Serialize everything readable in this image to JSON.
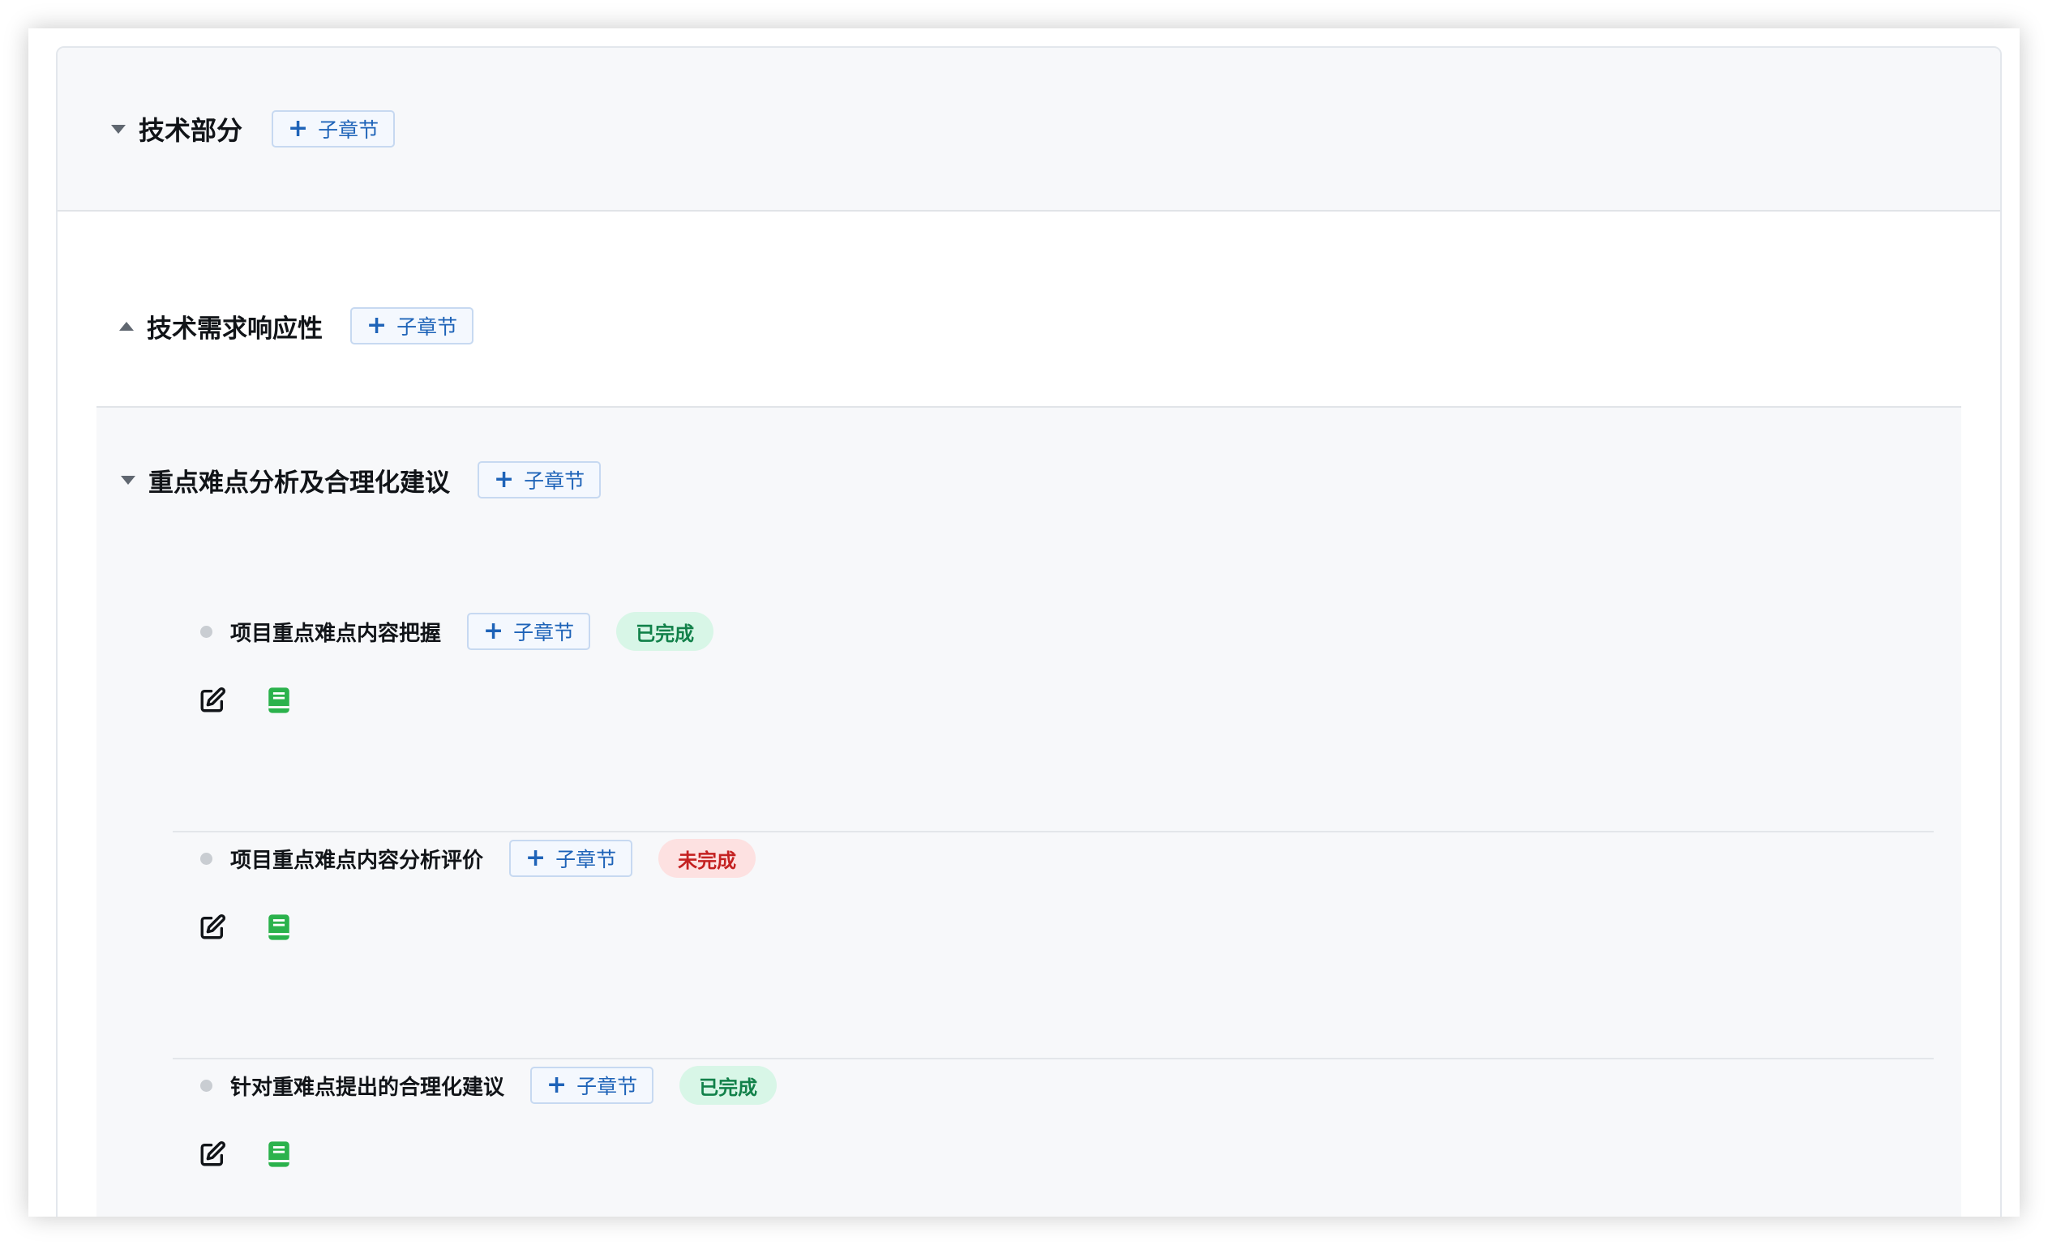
{
  "root": {
    "title": "技术部分",
    "add_label": "子章节",
    "plus": "+"
  },
  "sections": [
    {
      "title": "技术需求响应性",
      "add_label": "子章节",
      "expanded": false
    },
    {
      "title": "重点难点分析及合理化建议",
      "add_label": "子章节",
      "expanded": true,
      "items": [
        {
          "title": "项目重点难点内容把握",
          "add_label": "子章节",
          "status": "已完成",
          "status_type": "done"
        },
        {
          "title": "项目重点难点内容分析评价",
          "add_label": "子章节",
          "status": "未完成",
          "status_type": "todo"
        },
        {
          "title": "针对重难点提出的合理化建议",
          "add_label": "子章节",
          "status": "已完成",
          "status_type": "done"
        }
      ]
    }
  ],
  "icons": {
    "edit": "edit-icon",
    "book": "book-icon"
  },
  "colors": {
    "accent": "#1e63b8",
    "done_bg": "#d8f6e7",
    "done_text": "#12814a",
    "todo_bg": "#fde1e1",
    "todo_text": "#c42121",
    "book_green": "#2bb24c"
  }
}
